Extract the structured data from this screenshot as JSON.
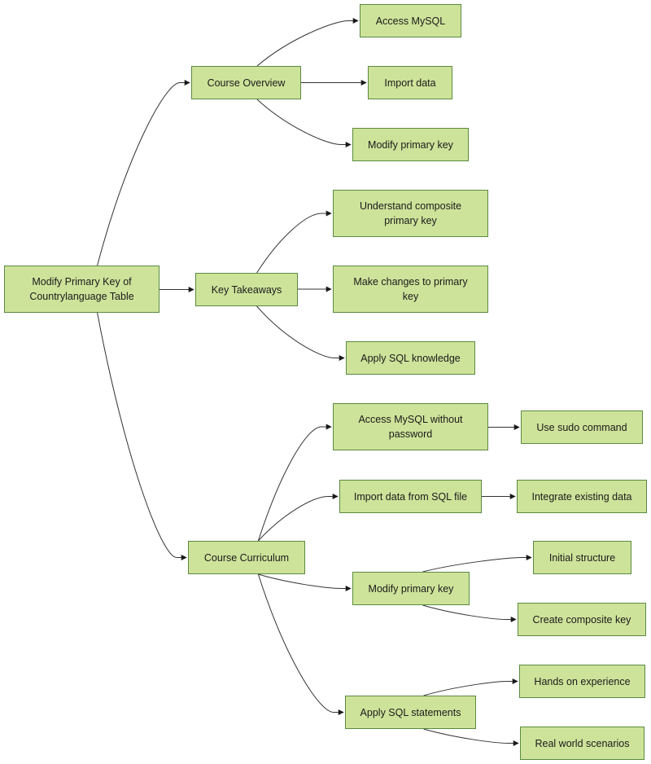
{
  "diagram": {
    "type": "mind-map",
    "colors": {
      "node_fill": "#cee39a",
      "node_border": "#5a8a40",
      "edge": "#333333",
      "text": "#1a1a1a"
    },
    "nodes": {
      "root": "Modify Primary Key of Countrylanguage Table",
      "overview": "Course Overview",
      "access_mysql": "Access MySQL",
      "import_data": "Import data",
      "modify_pk_1": "Modify primary key",
      "takeaways": "Key Takeaways",
      "understand_composite": "Understand composite primary key",
      "make_changes": "Make changes to primary key",
      "apply_sql_knowledge": "Apply SQL knowledge",
      "curriculum": "Course Curriculum",
      "access_no_pw": "Access MySQL without password",
      "use_sudo": "Use sudo command",
      "import_sql_file": "Import data from SQL file",
      "integrate_data": "Integrate existing data",
      "modify_pk_2": "Modify primary key",
      "initial_structure": "Initial structure",
      "create_composite": "Create composite key",
      "apply_sql_statements": "Apply SQL statements",
      "hands_on": "Hands on experience",
      "real_world": "Real world scenarios"
    },
    "edges": [
      [
        "root",
        "overview"
      ],
      [
        "root",
        "takeaways"
      ],
      [
        "root",
        "curriculum"
      ],
      [
        "overview",
        "access_mysql"
      ],
      [
        "overview",
        "import_data"
      ],
      [
        "overview",
        "modify_pk_1"
      ],
      [
        "takeaways",
        "understand_composite"
      ],
      [
        "takeaways",
        "make_changes"
      ],
      [
        "takeaways",
        "apply_sql_knowledge"
      ],
      [
        "curriculum",
        "access_no_pw"
      ],
      [
        "curriculum",
        "import_sql_file"
      ],
      [
        "curriculum",
        "modify_pk_2"
      ],
      [
        "curriculum",
        "apply_sql_statements"
      ],
      [
        "access_no_pw",
        "use_sudo"
      ],
      [
        "import_sql_file",
        "integrate_data"
      ],
      [
        "modify_pk_2",
        "initial_structure"
      ],
      [
        "modify_pk_2",
        "create_composite"
      ],
      [
        "apply_sql_statements",
        "hands_on"
      ],
      [
        "apply_sql_statements",
        "real_world"
      ]
    ]
  }
}
